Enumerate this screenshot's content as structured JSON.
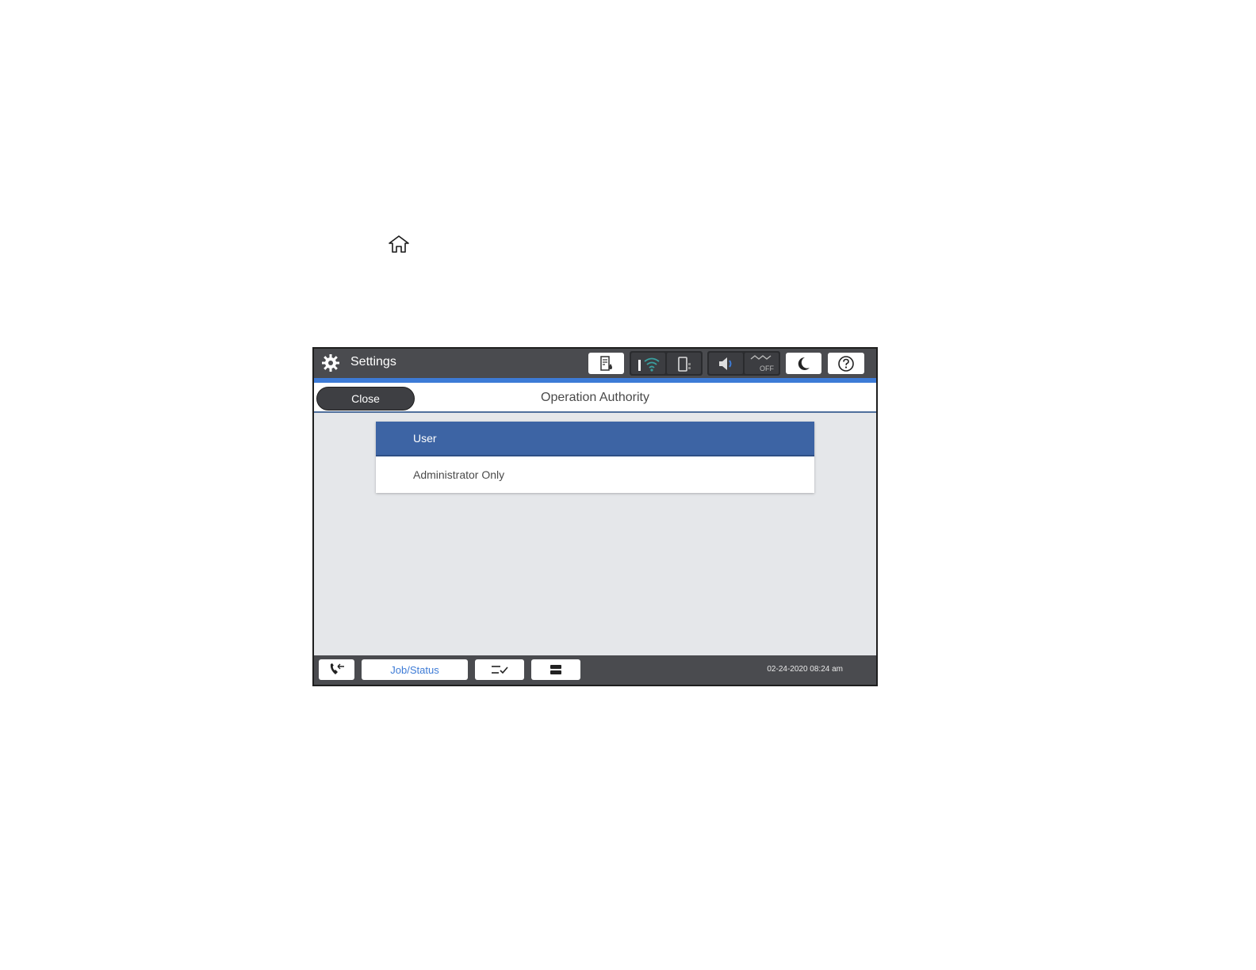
{
  "header": {
    "title": "Settings",
    "close_label": "Close",
    "screen_title": "Operation Authority"
  },
  "status_icons": [
    "ink-status-icon",
    "wifi-icon",
    "wifi-direct-icon",
    "sound-icon",
    "fax-off-icon",
    "sleep-icon",
    "help-icon"
  ],
  "status": {
    "fax_off_label": "OFF"
  },
  "options": [
    {
      "label": "User",
      "selected": true
    },
    {
      "label": "Administrator Only",
      "selected": false
    }
  ],
  "footer": {
    "job_status_label": "Job/Status",
    "datetime": "02-24-2020 08:24 am"
  },
  "colors": {
    "accent": "#3d7bd6",
    "selected_row": "#3d64a4",
    "bar": "#4a4b4f",
    "content_bg": "#e5e7ea"
  }
}
